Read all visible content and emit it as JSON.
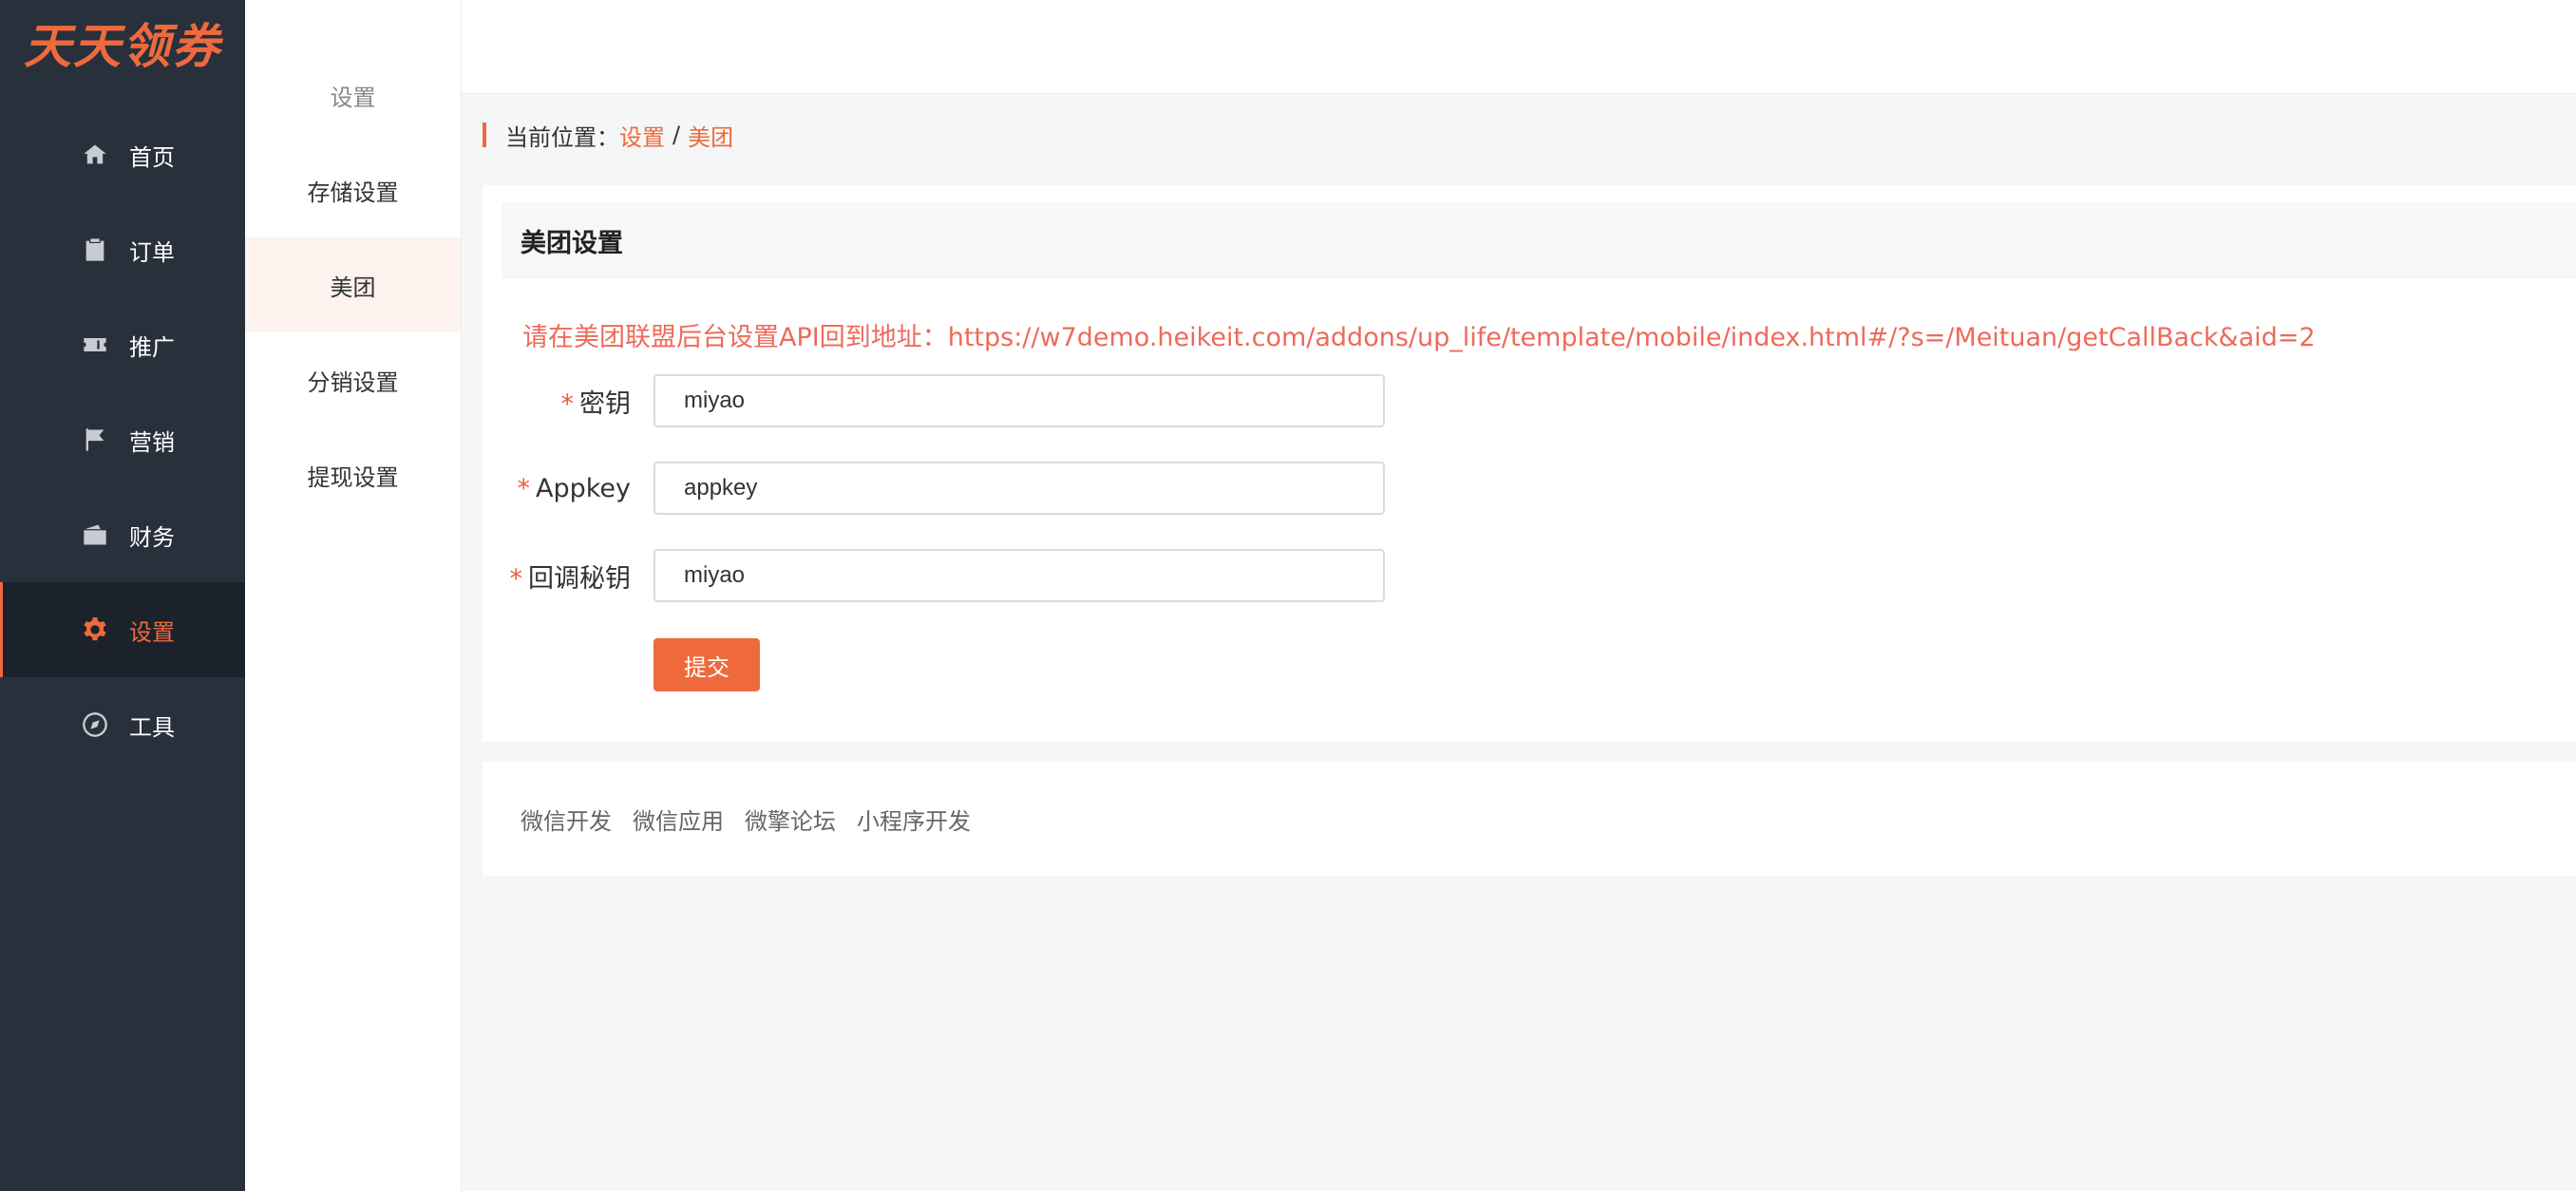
{
  "brand": {
    "logo_text": "天天领券",
    "accent": "#ee6a3c"
  },
  "sidebar": {
    "items": [
      {
        "label": "首页",
        "icon": "home-icon"
      },
      {
        "label": "订单",
        "icon": "clipboard-icon"
      },
      {
        "label": "推广",
        "icon": "ticket-icon"
      },
      {
        "label": "营销",
        "icon": "flag-icon"
      },
      {
        "label": "财务",
        "icon": "wallet-icon"
      },
      {
        "label": "设置",
        "icon": "gear-icon",
        "active": true
      },
      {
        "label": "工具",
        "icon": "compass-icon"
      }
    ]
  },
  "submenu": {
    "title": "设置",
    "items": [
      {
        "label": "存储设置"
      },
      {
        "label": "美团",
        "active": true
      },
      {
        "label": "分销设置"
      },
      {
        "label": "提现设置"
      }
    ]
  },
  "breadcrumb": {
    "prefix": "当前位置：",
    "level1": "设置",
    "separator": "/",
    "level2": "美团"
  },
  "card": {
    "title": "美团设置",
    "notice": "请在美团联盟后台设置API回到地址：https://w7demo.heikeit.com/addons/up_life/template/mobile/index.html#/?s=/Meituan/getCallBack&aid=2",
    "fields": [
      {
        "required_mark": "*",
        "label": "密钥",
        "value": "miyao"
      },
      {
        "required_mark": "*",
        "label": "Appkey",
        "value": "appkey"
      },
      {
        "required_mark": "*",
        "label": "回调秘钥",
        "value": "miyao"
      }
    ],
    "submit_label": "提交"
  },
  "footer": {
    "links": [
      "微信开发",
      "微信应用",
      "微擎论坛",
      "小程序开发"
    ]
  }
}
